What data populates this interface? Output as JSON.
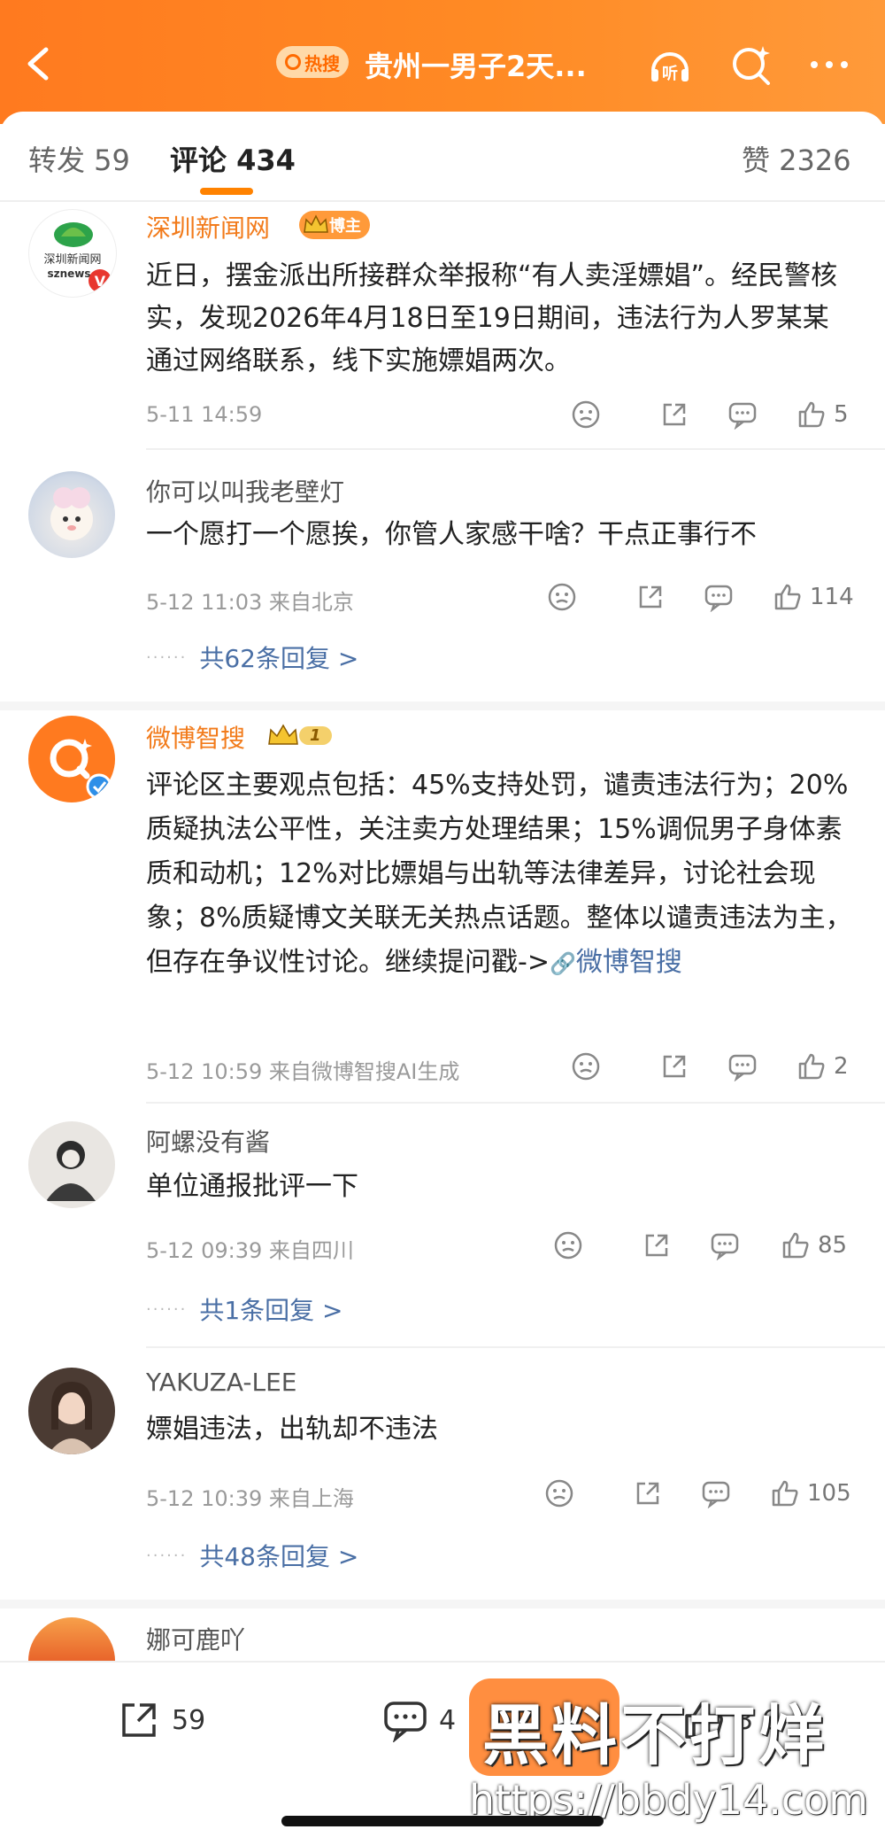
{
  "header": {
    "hot_badge": "热搜",
    "title": "贵州一男子2天...",
    "listen_label": "听",
    "colors": {
      "brand": "#ff8200",
      "hot_text": "#ff6a00"
    }
  },
  "tabs": {
    "repost_label": "转发 59",
    "comment_label": "评论 434",
    "like_label": "赞 2326"
  },
  "comments": [
    {
      "user": "深圳新闻网",
      "avatar_text": "深圳新闻网",
      "avatar_sub": "sznews",
      "badge": "博主",
      "text": "近日，摆金派出所接群众举报称“有人卖淫嫖娼”。经民警核实，发现2026年4月18日至19日期间，违法行为人罗某某通过网络联系，线下实施嫖娼两次。",
      "time": "5-11 14:59",
      "likes": "5"
    },
    {
      "user": "你可以叫我老壁灯",
      "text": "一个愿打一个愿挨，你管人家感干啥？干点正事行不",
      "time": "5-12 11:03 来自北京",
      "likes": "114",
      "replies": "共62条回复 >"
    },
    {
      "user": "微博智搜",
      "badge": "1",
      "text": "评论区主要观点包括：45%支持处罚，谴责违法行为；20%质疑执法公平性，关注卖方处理结果；15%调侃男子身体素质和动机；12%对比嫖娼与出轨等法律差异，讨论社会现象；8%质疑博文关联无关热点话题。整体以谴责违法为主，但存在争议性讨论。继续提问戳->",
      "link": "微博智搜",
      "time": "5-12 10:59 来自微博智搜AI生成",
      "likes": "2"
    },
    {
      "user": "阿螺没有酱",
      "text": "单位通报批评一下",
      "time": "5-12 09:39 来自四川",
      "likes": "85",
      "replies": "共1条回复 >"
    },
    {
      "user": "YAKUZA-LEE",
      "text": "嫖娼违法，出轨却不违法",
      "time": "5-12 10:39 来自上海",
      "likes": "105",
      "replies": "共48条回复 >"
    },
    {
      "user": "娜可鹿吖"
    }
  ],
  "bottom": {
    "repost_count": "59",
    "comment_count": "4",
    "like_count": "3 6"
  },
  "watermark": {
    "text": "黑料不打烊",
    "url": "https://bbdy14.com"
  }
}
